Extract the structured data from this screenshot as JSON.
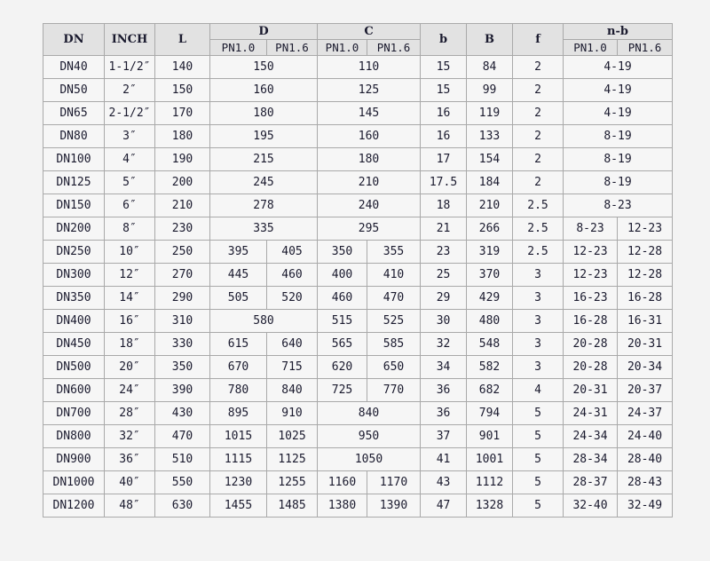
{
  "header": {
    "dn": "DN",
    "inch": "INCH",
    "l": "L",
    "d": "D",
    "c": "C",
    "b_small": "b",
    "b_big": "B",
    "f": "f",
    "nb": "n-b",
    "pn10": "PN1.0",
    "pn16": "PN1.6"
  },
  "rows": [
    {
      "dn": "DN40",
      "inch": "1-1/2″",
      "l": "140",
      "d": [
        "150"
      ],
      "c": [
        "110"
      ],
      "b": "15",
      "B": "84",
      "f": "2",
      "nb": [
        "4-19"
      ]
    },
    {
      "dn": "DN50",
      "inch": "2″",
      "l": "150",
      "d": [
        "160"
      ],
      "c": [
        "125"
      ],
      "b": "15",
      "B": "99",
      "f": "2",
      "nb": [
        "4-19"
      ]
    },
    {
      "dn": "DN65",
      "inch": "2-1/2″",
      "l": "170",
      "d": [
        "180"
      ],
      "c": [
        "145"
      ],
      "b": "16",
      "B": "119",
      "f": "2",
      "nb": [
        "4-19"
      ]
    },
    {
      "dn": "DN80",
      "inch": "3″",
      "l": "180",
      "d": [
        "195"
      ],
      "c": [
        "160"
      ],
      "b": "16",
      "B": "133",
      "f": "2",
      "nb": [
        "8-19"
      ]
    },
    {
      "dn": "DN100",
      "inch": "4″",
      "l": "190",
      "d": [
        "215"
      ],
      "c": [
        "180"
      ],
      "b": "17",
      "B": "154",
      "f": "2",
      "nb": [
        "8-19"
      ]
    },
    {
      "dn": "DN125",
      "inch": "5″",
      "l": "200",
      "d": [
        "245"
      ],
      "c": [
        "210"
      ],
      "b": "17.5",
      "B": "184",
      "f": "2",
      "nb": [
        "8-19"
      ]
    },
    {
      "dn": "DN150",
      "inch": "6″",
      "l": "210",
      "d": [
        "278"
      ],
      "c": [
        "240"
      ],
      "b": "18",
      "B": "210",
      "f": "2.5",
      "nb": [
        "8-23"
      ]
    },
    {
      "dn": "DN200",
      "inch": "8″",
      "l": "230",
      "d": [
        "335"
      ],
      "c": [
        "295"
      ],
      "b": "21",
      "B": "266",
      "f": "2.5",
      "nb": [
        "8-23",
        "12-23"
      ]
    },
    {
      "dn": "DN250",
      "inch": "10″",
      "l": "250",
      "d": [
        "395",
        "405"
      ],
      "c": [
        "350",
        "355"
      ],
      "b": "23",
      "B": "319",
      "f": "2.5",
      "nb": [
        "12-23",
        "12-28"
      ]
    },
    {
      "dn": "DN300",
      "inch": "12″",
      "l": "270",
      "d": [
        "445",
        "460"
      ],
      "c": [
        "400",
        "410"
      ],
      "b": "25",
      "B": "370",
      "f": "3",
      "nb": [
        "12-23",
        "12-28"
      ]
    },
    {
      "dn": "DN350",
      "inch": "14″",
      "l": "290",
      "d": [
        "505",
        "520"
      ],
      "c": [
        "460",
        "470"
      ],
      "b": "29",
      "B": "429",
      "f": "3",
      "nb": [
        "16-23",
        "16-28"
      ]
    },
    {
      "dn": "DN400",
      "inch": "16″",
      "l": "310",
      "d": [
        "580"
      ],
      "c": [
        "515",
        "525"
      ],
      "b": "30",
      "B": "480",
      "f": "3",
      "nb": [
        "16-28",
        "16-31"
      ]
    },
    {
      "dn": "DN450",
      "inch": "18″",
      "l": "330",
      "d": [
        "615",
        "640"
      ],
      "c": [
        "565",
        "585"
      ],
      "b": "32",
      "B": "548",
      "f": "3",
      "nb": [
        "20-28",
        "20-31"
      ]
    },
    {
      "dn": "DN500",
      "inch": "20″",
      "l": "350",
      "d": [
        "670",
        "715"
      ],
      "c": [
        "620",
        "650"
      ],
      "b": "34",
      "B": "582",
      "f": "3",
      "nb": [
        "20-28",
        "20-34"
      ]
    },
    {
      "dn": "DN600",
      "inch": "24″",
      "l": "390",
      "d": [
        "780",
        "840"
      ],
      "c": [
        "725",
        "770"
      ],
      "b": "36",
      "B": "682",
      "f": "4",
      "nb": [
        "20-31",
        "20-37"
      ]
    },
    {
      "dn": "DN700",
      "inch": "28″",
      "l": "430",
      "d": [
        "895",
        "910"
      ],
      "c": [
        "840"
      ],
      "b": "36",
      "B": "794",
      "f": "5",
      "nb": [
        "24-31",
        "24-37"
      ]
    },
    {
      "dn": "DN800",
      "inch": "32″",
      "l": "470",
      "d": [
        "1015",
        "1025"
      ],
      "c": [
        "950"
      ],
      "b": "37",
      "B": "901",
      "f": "5",
      "nb": [
        "24-34",
        "24-40"
      ]
    },
    {
      "dn": "DN900",
      "inch": "36″",
      "l": "510",
      "d": [
        "1115",
        "1125"
      ],
      "c": [
        "1050"
      ],
      "b": "41",
      "B": "1001",
      "f": "5",
      "nb": [
        "28-34",
        "28-40"
      ]
    },
    {
      "dn": "DN1000",
      "inch": "40″",
      "l": "550",
      "d": [
        "1230",
        "1255"
      ],
      "c": [
        "1160",
        "1170"
      ],
      "b": "43",
      "B": "1112",
      "f": "5",
      "nb": [
        "28-37",
        "28-43"
      ]
    },
    {
      "dn": "DN1200",
      "inch": "48″",
      "l": "630",
      "d": [
        "1455",
        "1485"
      ],
      "c": [
        "1380",
        "1390"
      ],
      "b": "47",
      "B": "1328",
      "f": "5",
      "nb": [
        "32-40",
        "32-49"
      ]
    }
  ]
}
